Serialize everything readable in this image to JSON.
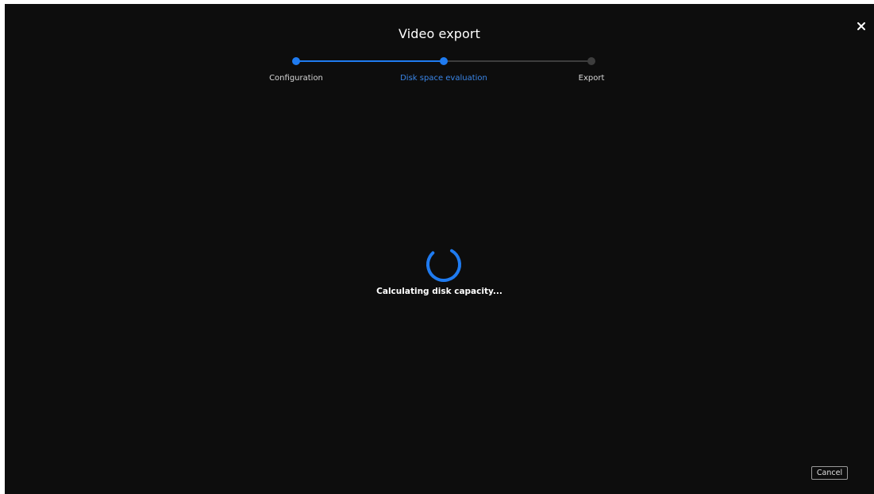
{
  "dialog": {
    "title": "Video export",
    "close_icon": "close-icon"
  },
  "stepper": {
    "steps": [
      {
        "label": "Configuration",
        "state": "completed"
      },
      {
        "label": "Disk space evaluation",
        "state": "active"
      },
      {
        "label": "Export",
        "state": "pending"
      }
    ],
    "colors": {
      "active": "#1f7bf0",
      "pending": "#3d3d3d"
    }
  },
  "status": {
    "icon": "loading-spinner-icon",
    "message": "Calculating disk capacity..."
  },
  "footer": {
    "cancel_label": "Cancel"
  },
  "colors": {
    "background": "#0d0d0d",
    "accent": "#1f7bf0",
    "text": "#ffffff"
  }
}
